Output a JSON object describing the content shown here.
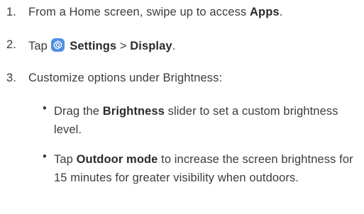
{
  "steps": [
    {
      "number": "1.",
      "pre": "From a Home screen, swipe up to access ",
      "bold": "Apps",
      "post": "."
    },
    {
      "number": "2.",
      "pre": "Tap ",
      "icon": "settings-icon",
      "bold1": "Settings",
      "sep": " > ",
      "bold2": "Display",
      "post": "."
    },
    {
      "number": "3.",
      "text": "Customize options under Brightness:"
    }
  ],
  "bullets": [
    {
      "symbol": "•",
      "pre": "Drag the ",
      "bold": "Brightness",
      "post": " slider to set a custom brightness level."
    },
    {
      "symbol": "•",
      "pre": "Tap ",
      "bold": "Outdoor mode",
      "post": " to increase the screen brightness for 15 minutes for greater visibility when outdoors."
    }
  ],
  "colors": {
    "text": "#3c3c3c",
    "icon_bg": "#4e8fe4"
  }
}
